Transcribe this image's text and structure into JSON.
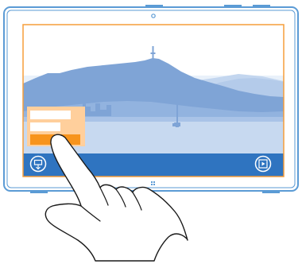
{
  "illustration": {
    "colors": {
      "device_outline": "#5b9bd5",
      "frame_highlight": "#f59d3a",
      "sky": "#dde9f5",
      "mountain_dark": "#7fa4d6",
      "mountain_mid": "#a6c2e6",
      "mountain_light": "#c3d6ef",
      "water": "#c7d9f0",
      "app_bar": "#2f74c0",
      "popup_fill": "#ffcf9c",
      "popup_accent": "#f7941d",
      "hand_line": "#1a1a1a"
    },
    "icons": {
      "left_button": "tile-icon",
      "right_button": "slideshow-icon",
      "bottom_center": "windows-logo-icon",
      "top_center": "camera-icon"
    }
  }
}
